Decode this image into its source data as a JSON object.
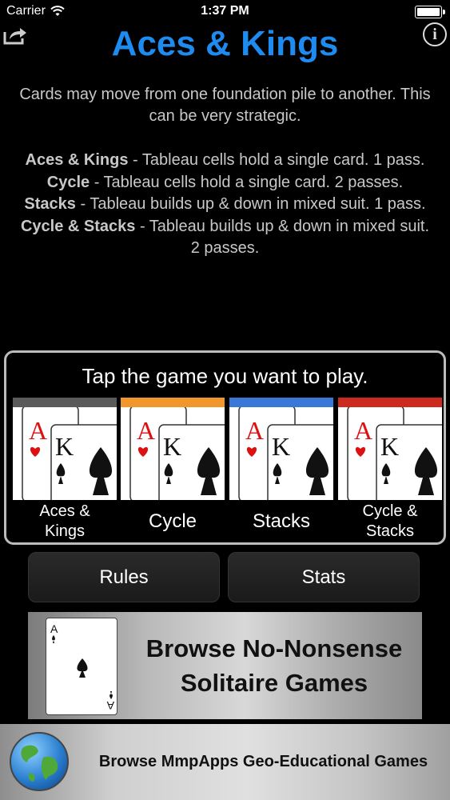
{
  "status_bar": {
    "carrier": "Carrier",
    "time": "1:37 PM"
  },
  "header": {
    "title": "Aces & Kings",
    "share_icon": "share-icon",
    "info_icon": "info-icon"
  },
  "description": {
    "intro": "Cards may move from one foundation pile to another. This can be very strategic.",
    "modes": [
      {
        "name": "Aces & Kings",
        "detail": " - Tableau cells hold a single card. 1 pass."
      },
      {
        "name": "Cycle",
        "detail": " - Tableau cells hold a single card. 2 passes."
      },
      {
        "name": "Stacks",
        "detail": " - Tableau builds up & down in mixed suit. 1 pass."
      },
      {
        "name": "Cycle & Stacks",
        "detail": " - Tableau builds up & down in mixed suit. 2 passes."
      }
    ]
  },
  "chooser": {
    "prompt": "Tap the game you want to play.",
    "games": [
      {
        "label": "Aces & Kings",
        "line1": "Aces &",
        "line2": "Kings",
        "color": "#5a5a5a"
      },
      {
        "label": "Cycle",
        "color": "#f0962a"
      },
      {
        "label": "Stacks",
        "color": "#3a78d8"
      },
      {
        "label": "Cycle & Stacks",
        "line1": "Cycle &",
        "line2": "Stacks",
        "color": "#cc2a1e"
      }
    ],
    "card_ranks": {
      "ace": "A",
      "king": "K"
    }
  },
  "buttons": {
    "rules": "Rules",
    "stats": "Stats"
  },
  "banner_solitaire": {
    "line1": "Browse No-Nonsense",
    "line2": "Solitaire Games",
    "card_rank": "A"
  },
  "banner_geo": {
    "text": "Browse MmpApps Geo-Educational Games"
  }
}
